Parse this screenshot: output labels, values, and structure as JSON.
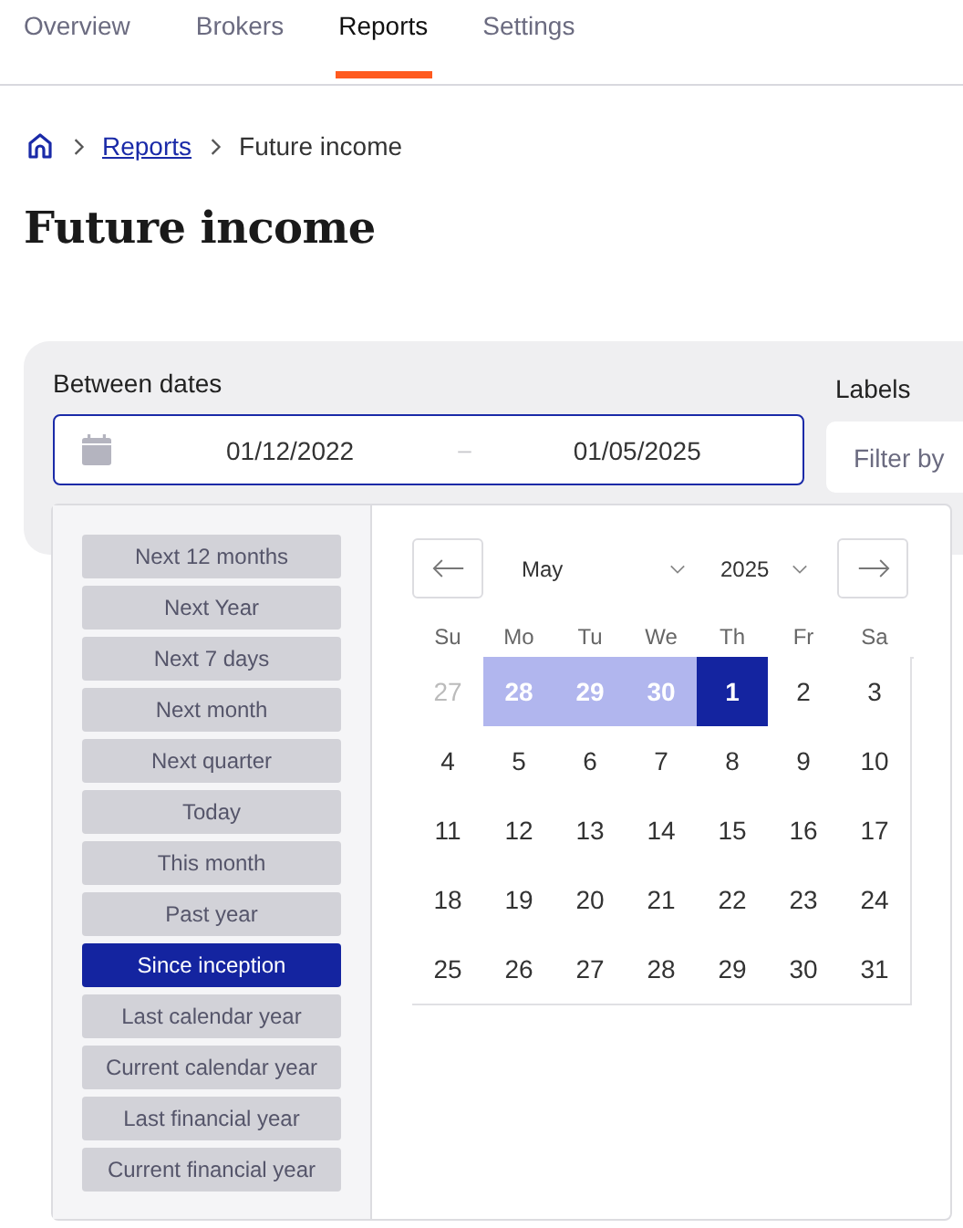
{
  "nav_tabs": [
    {
      "label": "Overview",
      "selected": false
    },
    {
      "label": "Brokers",
      "selected": false
    },
    {
      "label": "Reports",
      "selected": true
    },
    {
      "label": "Settings",
      "selected": false
    }
  ],
  "breadcrumb": {
    "links": [
      "Reports"
    ],
    "current": "Future income"
  },
  "title": "Future income",
  "filters": {
    "date_label": "Between dates",
    "start": "01/12/2022",
    "separator": "–",
    "end": "01/05/2025",
    "labels_label": "Labels",
    "labels_placeholder": "Filter by"
  },
  "date_picker": {
    "presets": [
      {
        "label": "Next 12 months",
        "selected": false
      },
      {
        "label": "Next Year",
        "selected": false
      },
      {
        "label": "Next 7 days",
        "selected": false
      },
      {
        "label": "Next month",
        "selected": false
      },
      {
        "label": "Next quarter",
        "selected": false
      },
      {
        "label": "Today",
        "selected": false
      },
      {
        "label": "This month",
        "selected": false
      },
      {
        "label": "Past year",
        "selected": false
      },
      {
        "label": "Since inception",
        "selected": true
      },
      {
        "label": "Last calendar year",
        "selected": false
      },
      {
        "label": "Current calendar year",
        "selected": false
      },
      {
        "label": "Last financial year",
        "selected": false
      },
      {
        "label": "Current financial year",
        "selected": false
      }
    ],
    "month": "May",
    "year": "2025",
    "weekdays": [
      "Su",
      "Mo",
      "Tu",
      "We",
      "Th",
      "Fr",
      "Sa"
    ],
    "days": [
      {
        "label": "27",
        "outside": true,
        "in_range": false,
        "selected": false
      },
      {
        "label": "28",
        "outside": true,
        "in_range": true,
        "selected": false
      },
      {
        "label": "29",
        "outside": true,
        "in_range": true,
        "selected": false
      },
      {
        "label": "30",
        "outside": true,
        "in_range": true,
        "selected": false
      },
      {
        "label": "1",
        "outside": false,
        "in_range": false,
        "selected": true
      },
      {
        "label": "2",
        "outside": false,
        "in_range": false,
        "selected": false
      },
      {
        "label": "3",
        "outside": false,
        "in_range": false,
        "selected": false
      },
      {
        "label": "4",
        "outside": false,
        "in_range": false,
        "selected": false
      },
      {
        "label": "5",
        "outside": false,
        "in_range": false,
        "selected": false
      },
      {
        "label": "6",
        "outside": false,
        "in_range": false,
        "selected": false
      },
      {
        "label": "7",
        "outside": false,
        "in_range": false,
        "selected": false
      },
      {
        "label": "8",
        "outside": false,
        "in_range": false,
        "selected": false
      },
      {
        "label": "9",
        "outside": false,
        "in_range": false,
        "selected": false
      },
      {
        "label": "10",
        "outside": false,
        "in_range": false,
        "selected": false
      },
      {
        "label": "11",
        "outside": false,
        "in_range": false,
        "selected": false
      },
      {
        "label": "12",
        "outside": false,
        "in_range": false,
        "selected": false
      },
      {
        "label": "13",
        "outside": false,
        "in_range": false,
        "selected": false
      },
      {
        "label": "14",
        "outside": false,
        "in_range": false,
        "selected": false
      },
      {
        "label": "15",
        "outside": false,
        "in_range": false,
        "selected": false
      },
      {
        "label": "16",
        "outside": false,
        "in_range": false,
        "selected": false
      },
      {
        "label": "17",
        "outside": false,
        "in_range": false,
        "selected": false
      },
      {
        "label": "18",
        "outside": false,
        "in_range": false,
        "selected": false
      },
      {
        "label": "19",
        "outside": false,
        "in_range": false,
        "selected": false
      },
      {
        "label": "20",
        "outside": false,
        "in_range": false,
        "selected": false
      },
      {
        "label": "21",
        "outside": false,
        "in_range": false,
        "selected": false
      },
      {
        "label": "22",
        "outside": false,
        "in_range": false,
        "selected": false
      },
      {
        "label": "23",
        "outside": false,
        "in_range": false,
        "selected": false
      },
      {
        "label": "24",
        "outside": false,
        "in_range": false,
        "selected": false
      },
      {
        "label": "25",
        "outside": false,
        "in_range": false,
        "selected": false
      },
      {
        "label": "26",
        "outside": false,
        "in_range": false,
        "selected": false
      },
      {
        "label": "27",
        "outside": false,
        "in_range": false,
        "selected": false
      },
      {
        "label": "28",
        "outside": false,
        "in_range": false,
        "selected": false
      },
      {
        "label": "29",
        "outside": false,
        "in_range": false,
        "selected": false
      },
      {
        "label": "30",
        "outside": false,
        "in_range": false,
        "selected": false
      },
      {
        "label": "31",
        "outside": false,
        "in_range": false,
        "selected": false
      }
    ]
  }
}
